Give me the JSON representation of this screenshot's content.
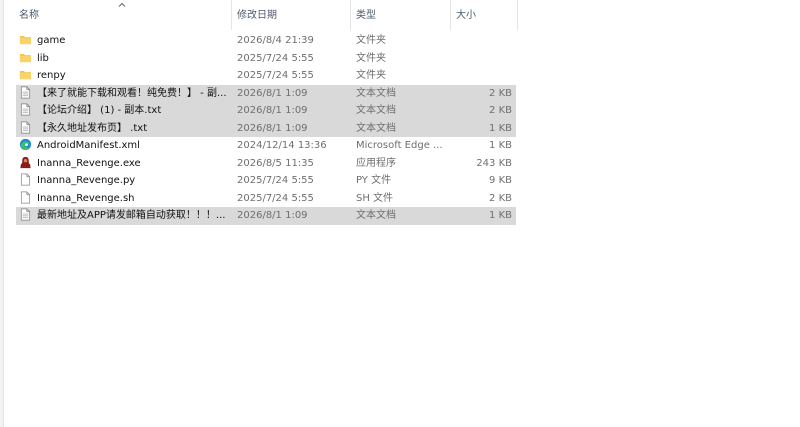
{
  "columns": {
    "name": "名称",
    "modified": "修改日期",
    "type": "类型",
    "size": "大小"
  },
  "sort": {
    "column": "name",
    "direction": "ascending",
    "icon": "chevron-up-icon"
  },
  "colors": {
    "selected_row": "#d9d9d9",
    "folder": "#f4c542",
    "edge_blue": "#1e88d8",
    "edge_green": "#3fbe6a",
    "exe_red": "#8b1a1a"
  },
  "files": [
    {
      "name": "game",
      "modified": "2026/8/4 21:39",
      "type": "文件夹",
      "size": "",
      "icon": "folder-icon",
      "selected": false
    },
    {
      "name": "lib",
      "modified": "2025/7/24 5:55",
      "type": "文件夹",
      "size": "",
      "icon": "folder-icon",
      "selected": false
    },
    {
      "name": "renpy",
      "modified": "2025/7/24 5:55",
      "type": "文件夹",
      "size": "",
      "icon": "folder-icon",
      "selected": false
    },
    {
      "name": "【来了就能下载和观看！纯免费！】 - 副...",
      "modified": "2026/8/1 1:09",
      "type": "文本文档",
      "size": "2 KB",
      "icon": "text-document-icon",
      "selected": true
    },
    {
      "name": "【论坛介绍】 (1) - 副本.txt",
      "modified": "2026/8/1 1:09",
      "type": "文本文档",
      "size": "2 KB",
      "icon": "text-document-icon",
      "selected": true
    },
    {
      "name": "【永久地址发布页】 .txt",
      "modified": "2026/8/1 1:09",
      "type": "文本文档",
      "size": "1 KB",
      "icon": "text-document-icon",
      "selected": true
    },
    {
      "name": "AndroidManifest.xml",
      "modified": "2024/12/14 13:36",
      "type": "Microsoft Edge ...",
      "size": "1 KB",
      "icon": "edge-icon",
      "selected": false
    },
    {
      "name": "Inanna_Revenge.exe",
      "modified": "2026/8/5 11:35",
      "type": "应用程序",
      "size": "243 KB",
      "icon": "app-exe-icon",
      "selected": false
    },
    {
      "name": "Inanna_Revenge.py",
      "modified": "2025/7/24 5:55",
      "type": "PY 文件",
      "size": "9 KB",
      "icon": "blank-file-icon",
      "selected": false
    },
    {
      "name": "Inanna_Revenge.sh",
      "modified": "2025/7/24 5:55",
      "type": "SH 文件",
      "size": "2 KB",
      "icon": "blank-file-icon",
      "selected": false
    },
    {
      "name": "最新地址及APP请发邮箱自动获取！！！...",
      "modified": "2026/8/1 1:09",
      "type": "文本文档",
      "size": "1 KB",
      "icon": "text-document-icon",
      "selected": true
    }
  ]
}
